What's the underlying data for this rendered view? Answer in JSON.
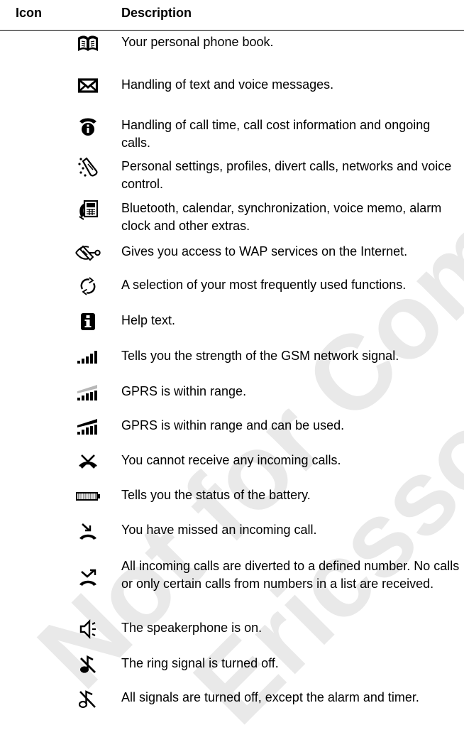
{
  "header": {
    "icon_label": "Icon",
    "description_label": "Description"
  },
  "watermark": {
    "line1": "Not for Commercial Use",
    "line2": "Ericsson Mobile Communications"
  },
  "rows": [
    {
      "icon": "phonebook-icon",
      "text": "Your personal phone book."
    },
    {
      "icon": "messages-envelope-icon",
      "text": "Handling of text and voice messages."
    },
    {
      "icon": "call-info-phone-icon",
      "text": "Handling of call time, call cost information and ongoing calls."
    },
    {
      "icon": "settings-phone-icon",
      "text": "Personal settings, profiles, divert calls, networks and voice control."
    },
    {
      "icon": "extras-calendar-icon",
      "text": "Bluetooth, calendar, synchronization, voice memo, alarm clock and other extras."
    },
    {
      "icon": "wap-internet-icon",
      "text": "Gives you access to WAP services on the Internet."
    },
    {
      "icon": "shortcuts-arrows-icon",
      "text": "A selection of your most frequently used functions."
    },
    {
      "icon": "help-info-icon",
      "text": "Help text."
    },
    {
      "icon": "signal-strength-icon",
      "text": "Tells you the strength of the GSM network signal."
    },
    {
      "icon": "gprs-in-range-icon",
      "text": "GPRS is within range."
    },
    {
      "icon": "gprs-usable-icon",
      "text": "GPRS is within range and can be used."
    },
    {
      "icon": "no-incoming-calls-icon",
      "text": "You cannot receive any incoming calls."
    },
    {
      "icon": "battery-icon",
      "text": "Tells you the status of the battery."
    },
    {
      "icon": "missed-call-icon",
      "text": "You have missed an incoming call."
    },
    {
      "icon": "divert-calls-icon",
      "text": "All incoming calls are diverted to a defined number. No calls or only certain calls from numbers in a list are received."
    },
    {
      "icon": "speakerphone-icon",
      "text": "The speakerphone is on."
    },
    {
      "icon": "ring-off-icon",
      "text": "The ring signal is turned off."
    },
    {
      "icon": "all-signals-off-icon",
      "text": "All signals are turned off, except the alarm and timer."
    }
  ]
}
